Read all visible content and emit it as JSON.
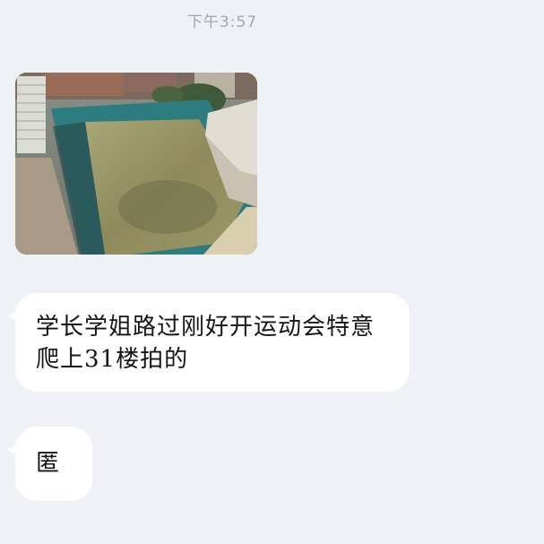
{
  "chat": {
    "timestamp": "下午3:57",
    "messages": [
      {
        "type": "image",
        "icon": "stadium-aerial-photo"
      },
      {
        "type": "text",
        "text": "学长学姐路过刚好开运动会特意爬上31楼拍的"
      },
      {
        "type": "text",
        "text": "匿"
      }
    ]
  },
  "colors": {
    "background": "#eff1f6",
    "bubble": "#ffffff",
    "timestamp": "#a2a6ae",
    "text": "#151515"
  }
}
